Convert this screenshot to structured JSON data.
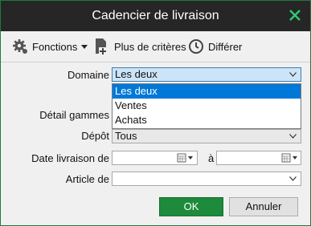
{
  "window": {
    "title": "Cadencier de livraison"
  },
  "toolbar": {
    "fonctions": "Fonctions",
    "plus": "Plus de critères",
    "differer": "Différer"
  },
  "form": {
    "domaine_label": "Domaine",
    "domaine_value": "Les deux",
    "domaine_options": [
      "Les deux",
      "Ventes",
      "Achats"
    ],
    "detail_label": "Détail gammes",
    "depot_label": "Dépôt",
    "depot_value": "Tous",
    "date_label": "Date livraison de",
    "date_sep": "à",
    "article_label": "Article de"
  },
  "buttons": {
    "ok": "OK",
    "cancel": "Annuler"
  },
  "colors": {
    "accent": "#1e8a3c",
    "titlebar": "#262626",
    "highlight": "#0078d7"
  }
}
